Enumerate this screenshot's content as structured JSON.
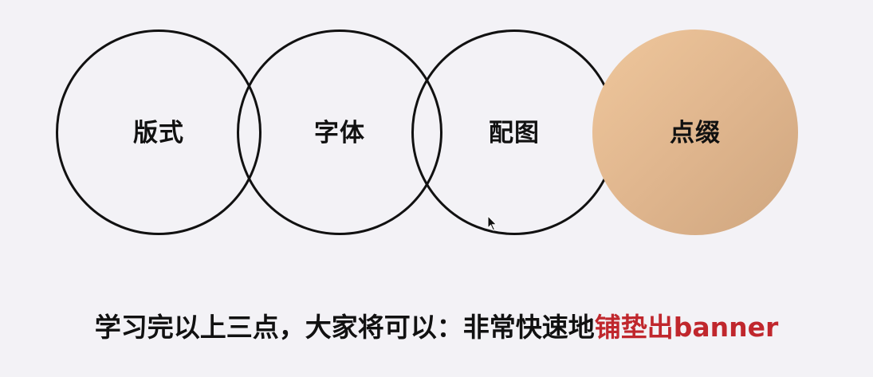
{
  "circles": [
    {
      "label": "版式",
      "filled": false
    },
    {
      "label": "字体",
      "filled": false
    },
    {
      "label": "配图",
      "filled": false
    },
    {
      "label": "点缀",
      "filled": true
    }
  ],
  "caption": {
    "main": "学习完以上三点，大家将可以：非常快速地",
    "highlight": "铺垫出banner"
  },
  "colors": {
    "background": "#f3f2f6",
    "circle_stroke": "#111111",
    "accent_fill": "#e0b68e",
    "highlight_text": "#c0272d"
  }
}
